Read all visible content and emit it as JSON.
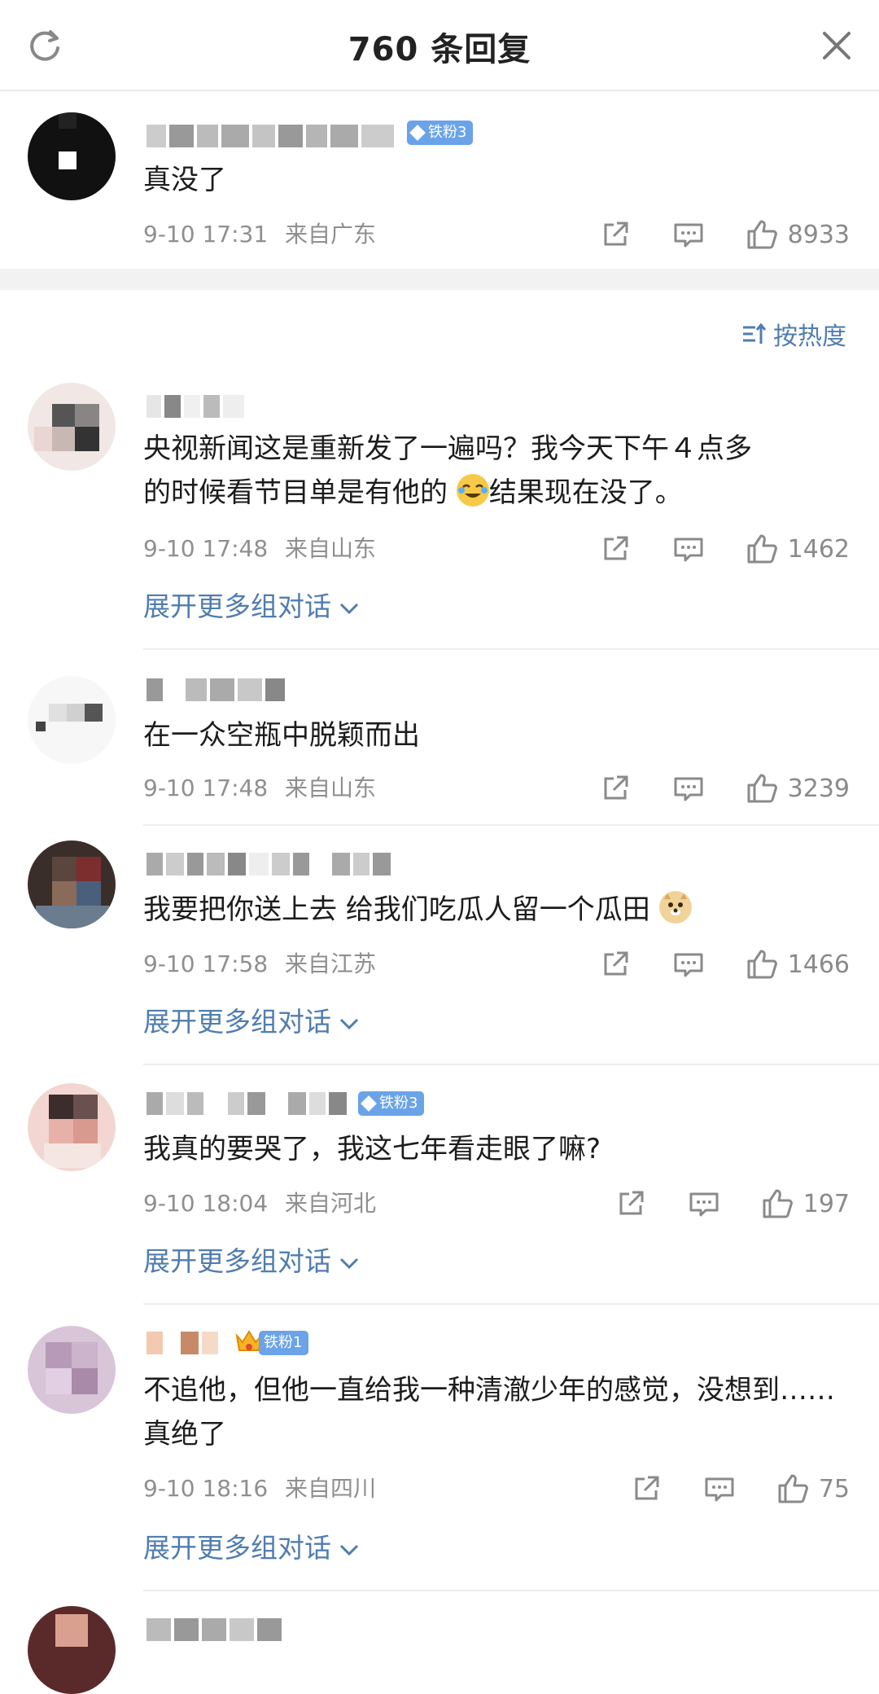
{
  "header": {
    "title": "760 条回复"
  },
  "sort_label": "按热度",
  "top_comment": {
    "badge": "铁粉3",
    "text": "真没了",
    "time": "9-10 17:31",
    "location": "来自广东",
    "likes": "8933"
  },
  "expand_label": "展开更多组对话",
  "comments": [
    {
      "text_a": "央视新闻这是重新发了一遍吗？我今天下午４点多",
      "text_b": "的时候看节目单是有他的",
      "text_c": "结果现在没了。",
      "time": "9-10 17:48",
      "location": "来自山东",
      "likes": "1462"
    },
    {
      "text": "在一众空瓶中脱颖而出",
      "time": "9-10 17:48",
      "location": "来自山东",
      "likes": "3239"
    },
    {
      "text_a": "我要把你送上去  给我们吃瓜人留一个瓜田",
      "time": "9-10 17:58",
      "location": "来自江苏",
      "likes": "1466"
    },
    {
      "badge": "铁粉3",
      "text": "我真的要哭了，我这七年看走眼了嘛?",
      "time": "9-10 18:04",
      "location": "来自河北",
      "likes": "197"
    },
    {
      "badge": "铁粉1",
      "text": "不追他，但他一直给我一种清澈少年的感觉，没想到……真绝了",
      "time": "9-10 18:16",
      "location": "来自四川",
      "likes": "75"
    }
  ],
  "icons": {
    "refresh": "refresh-icon",
    "close": "close-icon",
    "share": "share-icon",
    "comment": "comment-icon",
    "like": "thumbs-up-icon",
    "sort": "sort-icon",
    "chevron": "chevron-down-icon",
    "crying_emoji": "crying-laugh-emoji-icon",
    "doge_emoji": "doge-emoji-icon"
  },
  "colors": {
    "link": "#507daf",
    "badge": "#6aa3e8",
    "meta": "#8f8f8f"
  }
}
